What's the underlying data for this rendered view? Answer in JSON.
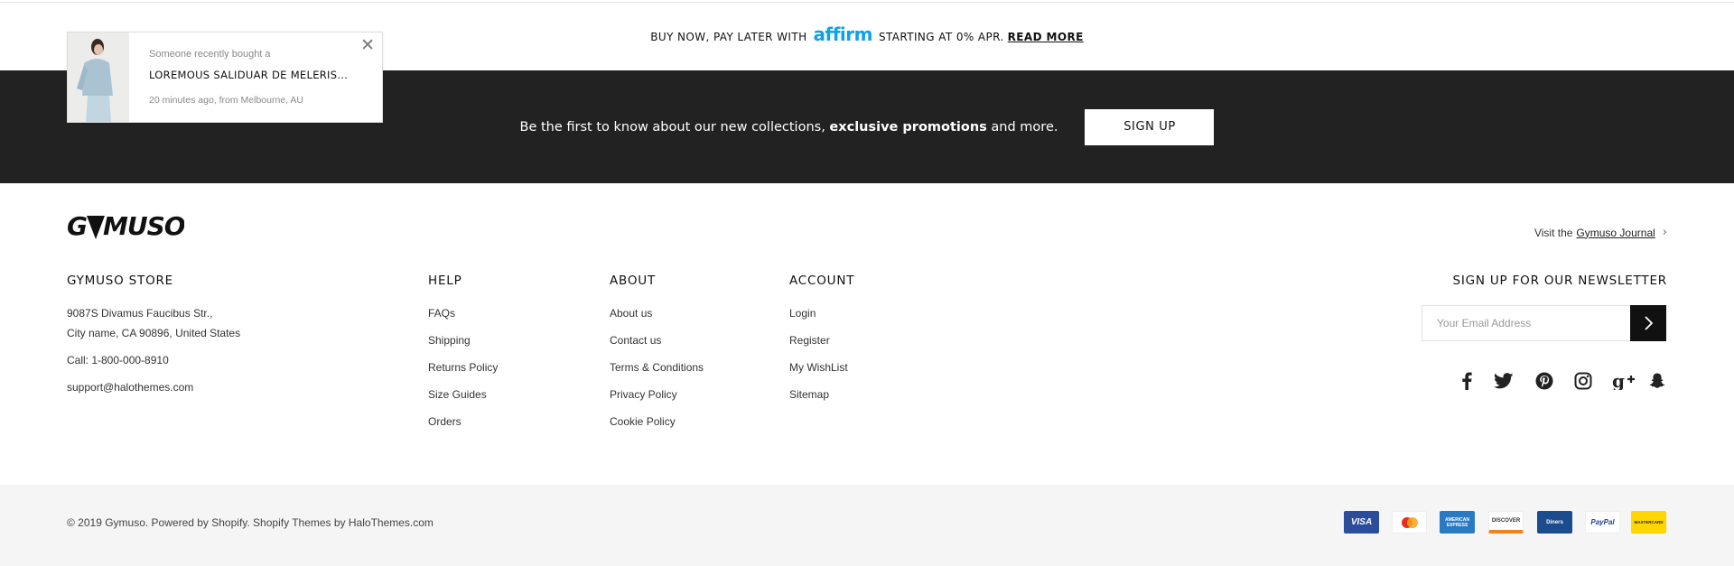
{
  "promo": {
    "prefix": "BUY NOW, PAY LATER WITH",
    "affirm_logo": "affirm",
    "suffix": "STARTING AT 0% APR.",
    "read_more": "READ MORE"
  },
  "signup_strip": {
    "text_before": "Be the first to know about our new collections, ",
    "text_bold": "exclusive promotions",
    "text_after": " and more.",
    "button": "SIGN UP"
  },
  "recent_purchase": {
    "line1": "Someone recently bought a",
    "product": "LOREMOUS SALIDUAR DE MELERIS...",
    "meta": "20 minutes ago, from Melbourne, AU",
    "close_icon": "close-icon"
  },
  "logo": {
    "text": "GYMUSO"
  },
  "journal": {
    "prefix": "Visit the",
    "link": "Gymuso Journal"
  },
  "store": {
    "heading": "GYMUSO STORE",
    "address1": "9087S Divamus Faucibus Str.,",
    "address2": "City name, CA 90896, United States",
    "phone": "Call: 1-800-000-8910",
    "email": "support@halothemes.com"
  },
  "help": {
    "heading": "HELP",
    "links": [
      "FAQs",
      "Shipping",
      "Returns Policy",
      "Size Guides",
      "Orders"
    ]
  },
  "about": {
    "heading": "ABOUT",
    "links": [
      "About us",
      "Contact us",
      "Terms & Conditions",
      "Privacy Policy",
      "Cookie Policy"
    ]
  },
  "account": {
    "heading": "ACCOUNT",
    "links": [
      "Login",
      "Register",
      "My WishList",
      "Sitemap"
    ]
  },
  "newsletter": {
    "heading": "SIGN UP FOR OUR NEWSLETTER",
    "placeholder": "Your Email Address"
  },
  "social_icons": [
    "facebook-icon",
    "twitter-icon",
    "pinterest-icon",
    "instagram-icon",
    "google-plus-icon",
    "snapchat-icon"
  ],
  "copyright": "© 2019 Gymuso. Powered by Shopify. Shopify Themes by HaloThemes.com",
  "payments": {
    "visa": "VISA",
    "mastercard": "mastercard-icon",
    "amex": "AMERICAN EXPRESS",
    "discover": "DISCOVER",
    "diners": "Diners",
    "paypal": "PayPal",
    "master_alt": "MASTERCARD"
  },
  "colors": {
    "dark_strip": "#222222",
    "affirm_blue": "#0fa0ea",
    "bottom_bar": "#f5f5f5"
  }
}
